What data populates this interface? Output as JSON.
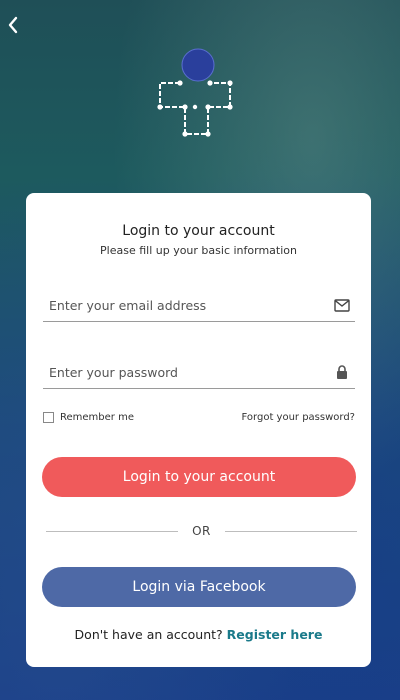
{
  "nav": {
    "back_icon": "chevron-left-icon"
  },
  "logo": {
    "icon": "medical-cross-circuit-logo",
    "colors": {
      "dot": "#2a3f9c",
      "outline": "#ffffff"
    }
  },
  "login_card": {
    "title": "Login to your account",
    "subtitle": "Please fill up your basic information",
    "email": {
      "placeholder": "Enter your email address",
      "value": "",
      "icon": "mail-icon"
    },
    "password": {
      "placeholder": "Enter your password",
      "value": "",
      "icon": "lock-icon"
    },
    "remember_label": "Remember me",
    "forgot_label": "Forgot your password?",
    "login_button": "Login to your account",
    "or_label": "OR",
    "facebook_button": "Login via Facebook",
    "register_prompt": "Don't have an account?",
    "register_link": "Register here"
  },
  "colors": {
    "login_button": "#f05a5b",
    "facebook_button": "#4e69a6",
    "register_link": "#1a7a8a"
  }
}
